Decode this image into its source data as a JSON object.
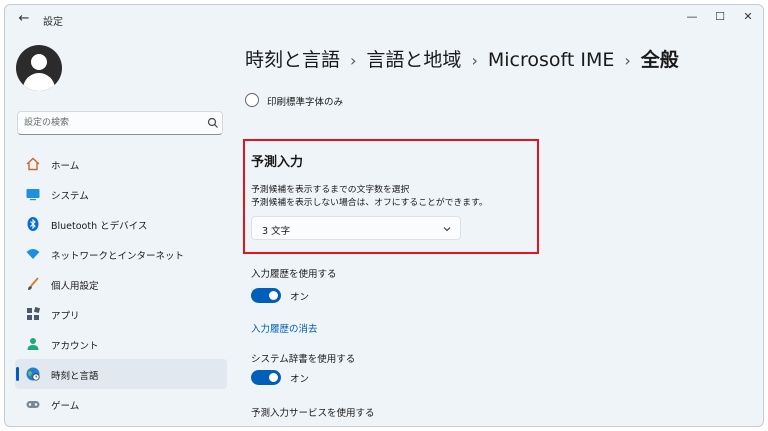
{
  "window": {
    "title": "設定"
  },
  "title_bar": {
    "back_icon": "back-arrow-icon",
    "minimize_icon": "minimize-icon",
    "maximize_icon": "maximize-icon",
    "close_icon": "close-icon"
  },
  "sidebar": {
    "search_placeholder": "設定の検索",
    "items": [
      {
        "label": "ホーム",
        "icon": "home-icon",
        "selected": false
      },
      {
        "label": "システム",
        "icon": "display-icon",
        "selected": false
      },
      {
        "label": "Bluetooth とデバイス",
        "icon": "bluetooth-icon",
        "selected": false
      },
      {
        "label": "ネットワークとインターネット",
        "icon": "wifi-icon",
        "selected": false
      },
      {
        "label": "個人用設定",
        "icon": "brush-icon",
        "selected": false
      },
      {
        "label": "アプリ",
        "icon": "apps-icon",
        "selected": false
      },
      {
        "label": "アカウント",
        "icon": "account-icon",
        "selected": false
      },
      {
        "label": "時刻と言語",
        "icon": "globe-clock-icon",
        "selected": true
      },
      {
        "label": "ゲーム",
        "icon": "gamepad-icon",
        "selected": false
      }
    ]
  },
  "breadcrumb": {
    "items": [
      "時刻と言語",
      "言語と地域",
      "Microsoft IME"
    ],
    "separator": "›",
    "current": "全般"
  },
  "main": {
    "radio_option": "印刷標準字体のみ",
    "prediction": {
      "title": "予測入力",
      "desc1": "予測候補を表示するまでの文字数を選択",
      "desc2": "予測候補を表示しない場合は、オフにすることができます。",
      "dropdown_value": "3 文字"
    },
    "input_history": {
      "label": "入力履歴を使用する",
      "toggle_text": "オン",
      "on": true
    },
    "clear_history_link": "入力履歴の消去",
    "system_dictionary": {
      "label": "システム辞書を使用する",
      "toggle_text": "オン",
      "on": true
    },
    "prediction_service": {
      "label": "予測入力サービスを使用する"
    }
  },
  "colors": {
    "accent": "#005fb8",
    "highlight_border": "#e5131b",
    "window_bg": "#eff4f9"
  }
}
